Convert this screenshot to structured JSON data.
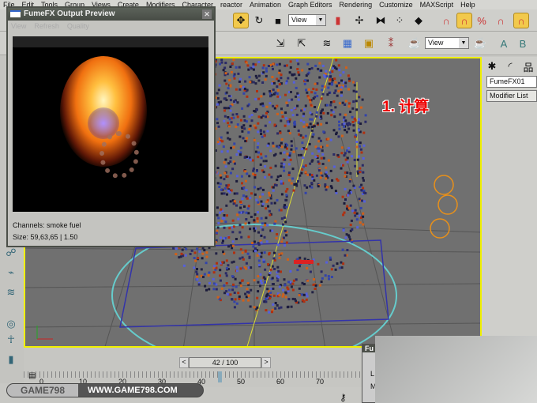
{
  "menu": [
    "File",
    "Edit",
    "Tools",
    "Group",
    "Views",
    "Create",
    "Modifiers",
    "Character",
    "reactor",
    "Animation",
    "Graph Editors",
    "Rendering",
    "Customize",
    "MAXScript",
    "Help"
  ],
  "toolbar": {
    "view_dropdown_1": "View",
    "view_dropdown_2": "View"
  },
  "fumefx_window": {
    "title": "FumeFX Output Preview",
    "menu": [
      "View",
      "Refresh",
      "Quality"
    ],
    "channels": "Channels: smoke fuel",
    "size": "Size: 59,63,65 | 1.50"
  },
  "annotation": "1. 计算",
  "command_panel": {
    "object_name": "FumeFX01",
    "modifier_list": "Modifier List"
  },
  "time_slider": {
    "label": "42 / 100",
    "value": 42,
    "max": 100,
    "prev": "<",
    "next": ">"
  },
  "ruler_ticks": [
    "0",
    "10",
    "20",
    "30",
    "40",
    "50",
    "60",
    "70"
  ],
  "small_window": {
    "title": "Fu",
    "rows": [
      "L",
      "M"
    ]
  },
  "watermark": {
    "left": "GAME798",
    "right": "WWW.GAME798.COM"
  },
  "colors": {
    "viewport_border": "#f0f000",
    "annotation": "#e00000",
    "selected_tool": "#f2c94c"
  }
}
